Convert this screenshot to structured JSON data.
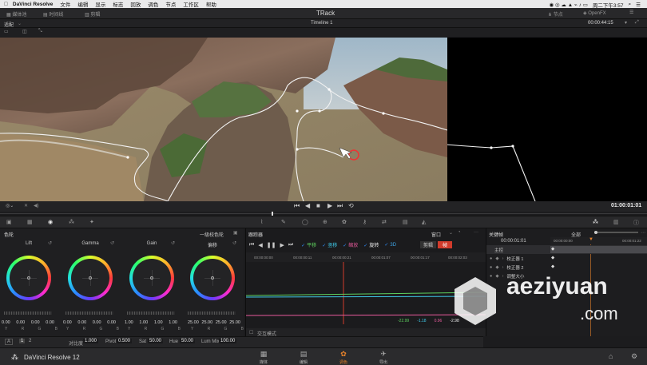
{
  "menubar": {
    "app": "DaVinci Resolve",
    "items": [
      "文件",
      "编辑",
      "显示",
      "标志",
      "回放",
      "调色",
      "节点",
      "工作区",
      "帮助"
    ],
    "clock": "周二下午3:57"
  },
  "titlebar": {
    "left_btn1": "媒体池",
    "left_btn2": "时间线",
    "left_btn3": "剪辑",
    "title": "TRack",
    "right_btn1": "节点",
    "right_btn2": "OpenFX"
  },
  "viewerbar": {
    "left": "适配",
    "timeline": "Timeline 1",
    "timecode": "00:00:44:15"
  },
  "viewer": {
    "timecode": "01:00:01:01"
  },
  "wheels": {
    "panel_title": "色轮",
    "mode": "一级校色轮",
    "items": [
      {
        "label": "Lift",
        "values": [
          "0.00",
          "0.00",
          "0.00",
          "0.00"
        ]
      },
      {
        "label": "Gamma",
        "values": [
          "0.00",
          "0.00",
          "0.00",
          "0.00"
        ]
      },
      {
        "label": "Gain",
        "values": [
          "1.00",
          "1.00",
          "1.00",
          "1.00"
        ]
      },
      {
        "label": "偏移",
        "values": [
          "25.00",
          "25.00",
          "25.00",
          "25.00"
        ]
      }
    ],
    "channels": [
      "Y",
      "R",
      "G",
      "B"
    ]
  },
  "curves": {
    "panel_title": "跟踪器",
    "window_label": "窗口",
    "checks": [
      "平移",
      "竖移",
      "缩放",
      "旋转",
      "3D"
    ],
    "clip_label": "剪辑",
    "frame_label": "帧",
    "ruler": [
      "00:00:00:00",
      "00:00:00:11",
      "00:00:00:21",
      "00:00:01:07",
      "00:00:01:17",
      "00:00:02:03"
    ],
    "readouts": [
      "-22.99",
      "-1.18",
      "0.96",
      "-2.98"
    ],
    "mode_label": "交互模式"
  },
  "keyframes": {
    "panel_title": "关键帧",
    "filter": "全部",
    "timecode": "00:00:01:01",
    "ruler": [
      "00:00:00:00",
      "00:00:01:22"
    ],
    "rows": [
      "主控",
      "校正器 1",
      "校正器 2",
      "调整大小"
    ]
  },
  "primbar": {
    "page_a": "A",
    "page1": "1",
    "page2": "2",
    "items": [
      {
        "label": "对比度",
        "value": "1.000"
      },
      {
        "label": "Pivot",
        "value": "0.500"
      },
      {
        "label": "Sat",
        "value": "50.00"
      },
      {
        "label": "Hue",
        "value": "50.00"
      },
      {
        "label": "Lum Mix",
        "value": "100.00"
      }
    ]
  },
  "pagebar": {
    "app": "DaVinci Resolve 12",
    "pages": [
      "媒体",
      "编辑",
      "调色",
      "导出"
    ]
  },
  "watermark": {
    "text1": "aeziyuan",
    ".com": ".com"
  }
}
